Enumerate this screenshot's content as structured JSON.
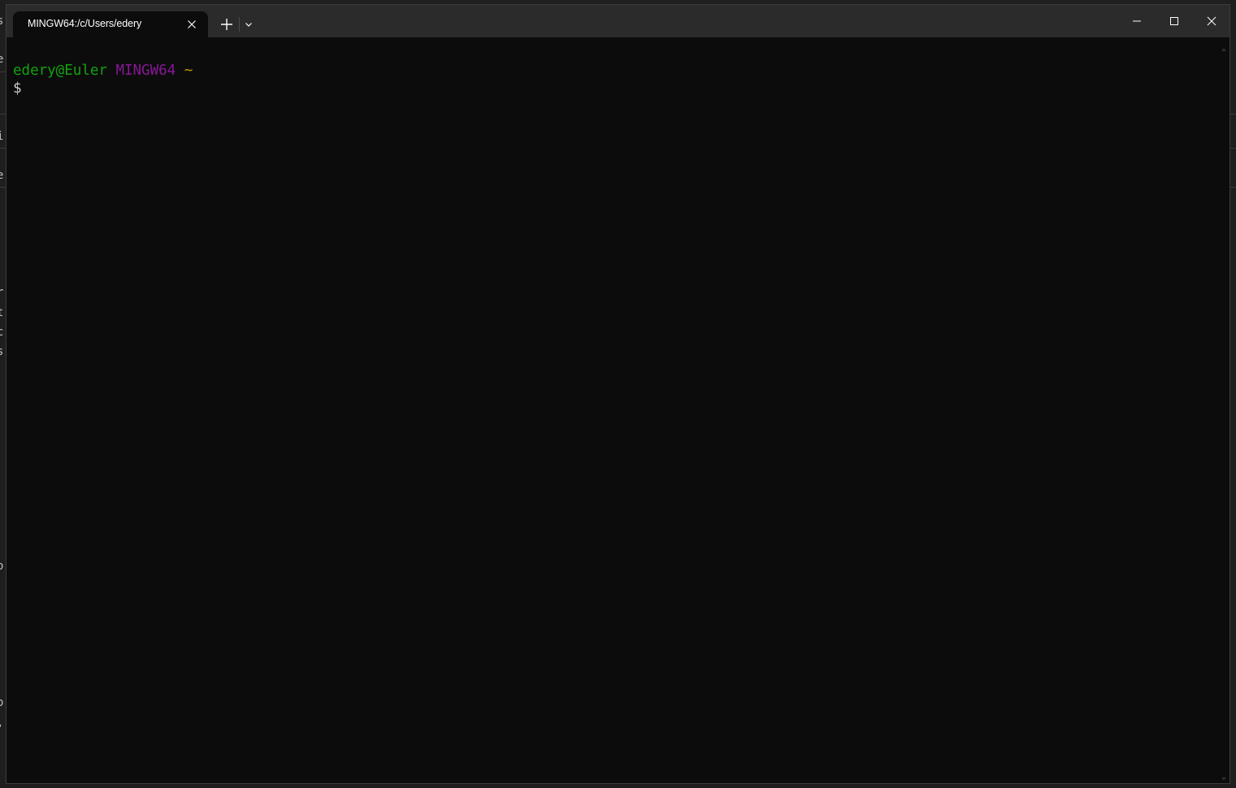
{
  "window": {
    "tab_title": "MINGW64:/c/Users/edery"
  },
  "terminal": {
    "user_host": "edery@Euler",
    "shell": "MINGW64",
    "cwd": "~",
    "prompt_symbol": "$"
  },
  "background_edge": {
    "glyphs": [
      "s",
      "e",
      "i",
      "e",
      "r",
      "t",
      "c",
      "s",
      "o",
      "o",
      ","
    ]
  },
  "colors": {
    "user_host": "#13a10e",
    "shell": "#881798",
    "cwd": "#c19c00",
    "terminal_bg": "#0c0c0c",
    "titlebar_bg": "#2b2b2b"
  },
  "icons": {
    "tab_close": "close-icon",
    "new_tab": "plus-icon",
    "dropdown": "chevron-down-icon",
    "minimize": "minimize-icon",
    "maximize": "maximize-icon",
    "close": "close-icon"
  }
}
